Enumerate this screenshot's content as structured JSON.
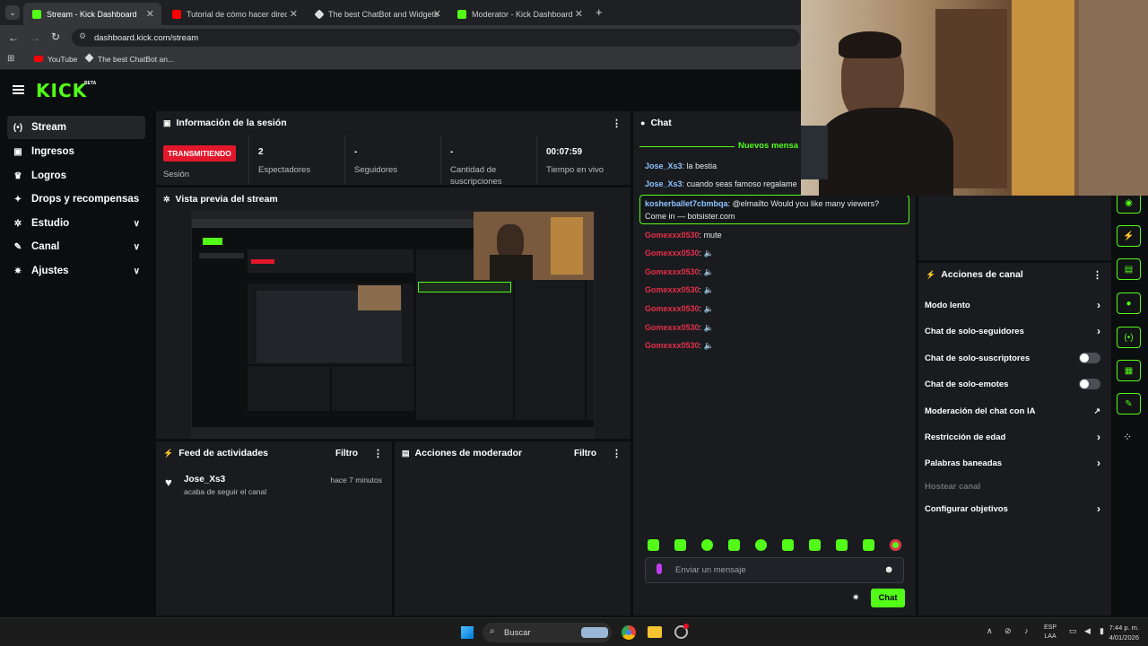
{
  "browser": {
    "tabs": [
      {
        "label": "Stream - Kick Dashboard",
        "active": true
      },
      {
        "label": "Tutorial de cómo hacer director",
        "active": false
      },
      {
        "label": "The best ChatBot and Widgets",
        "active": false
      },
      {
        "label": "Moderator - Kick Dashboard",
        "active": false
      }
    ],
    "url": "dashboard.kick.com/stream",
    "bookmarks": [
      "YouTube",
      "The best ChatBot an..."
    ]
  },
  "kick": {
    "logo": "KICK",
    "beta": "BETA",
    "accent": "#53fc18"
  },
  "sidebar": {
    "items": [
      {
        "label": "Stream",
        "icon": "broadcast-icon",
        "active": true
      },
      {
        "label": "Ingresos",
        "icon": "wallet-icon"
      },
      {
        "label": "Logros",
        "icon": "trophy-icon"
      },
      {
        "label": "Drops y recompensas",
        "icon": "gift-icon"
      },
      {
        "label": "Estudio",
        "icon": "studio-icon",
        "expandable": true
      },
      {
        "label": "Canal",
        "icon": "channel-icon",
        "expandable": true
      },
      {
        "label": "Ajustes",
        "icon": "gear-icon",
        "expandable": true
      }
    ]
  },
  "session": {
    "title": "Información de la sesión",
    "badge": "TRANSMITIENDO",
    "stats": [
      {
        "value": "",
        "label": "Sesión"
      },
      {
        "value": "2",
        "label": "Espectadores"
      },
      {
        "value": "-",
        "label": "Seguidores"
      },
      {
        "value": "-",
        "label": "Cantidad de suscripciones"
      },
      {
        "value": "00:07:59",
        "label": "Tiempo en vivo"
      }
    ]
  },
  "preview": {
    "title": "Vista previa del stream"
  },
  "activity": {
    "title": "Feed de actividades",
    "filter": "Filtro",
    "items": [
      {
        "user": "Jose_Xs3",
        "text": "acaba de seguir el canal",
        "time": "hace 7 minutos"
      }
    ]
  },
  "modactions": {
    "title": "Acciones de moderador",
    "filter": "Filtro"
  },
  "chat": {
    "title": "Chat",
    "new_messages": "Nuevos mensa",
    "messages": [
      {
        "user": "Jose_Xs3",
        "text": "la bestia"
      },
      {
        "user": "Jose_Xs3",
        "text": "cuando seas famoso regalame"
      },
      {
        "user": "kosherballet7cbmbqa",
        "text": "@elmailto Would you like many viewers?",
        "text2": "Come in — botsister.com"
      },
      {
        "user": "Gomexxx0530",
        "text": "mute"
      },
      {
        "user": "Gomexxx0530",
        "text": ""
      },
      {
        "user": "Gomexxx0530",
        "text": ""
      },
      {
        "user": "Gomexxx0530",
        "text": ""
      },
      {
        "user": "Gomexxx0530",
        "text": ""
      },
      {
        "user": "Gomexxx0530",
        "text": ""
      },
      {
        "user": "Gomexxx0530",
        "text": ""
      }
    ],
    "input_placeholder": "Enviar un mensaje",
    "send": "Chat"
  },
  "channel_actions": {
    "title": "Acciones de canal",
    "items": [
      {
        "label": "Modo lento",
        "control": "chevron"
      },
      {
        "label": "Chat de solo-seguidores",
        "control": "chevron"
      },
      {
        "label": "Chat de solo-suscriptores",
        "control": "toggle"
      },
      {
        "label": "Chat de solo-emotes",
        "control": "toggle"
      },
      {
        "label": "Moderación del chat con IA",
        "control": "external"
      },
      {
        "label": "Restricción de edad",
        "control": "chevron"
      },
      {
        "label": "Palabras baneadas",
        "control": "chevron"
      },
      {
        "label": "Hostear canal",
        "control": "disabled"
      },
      {
        "label": "Configurar objetivos",
        "control": "chevron"
      }
    ]
  },
  "taskbar": {
    "search": "Buscar",
    "lang": "ESP",
    "lang2": "LAA",
    "time": "7:44 p. m.",
    "date": "4/01/2026"
  }
}
